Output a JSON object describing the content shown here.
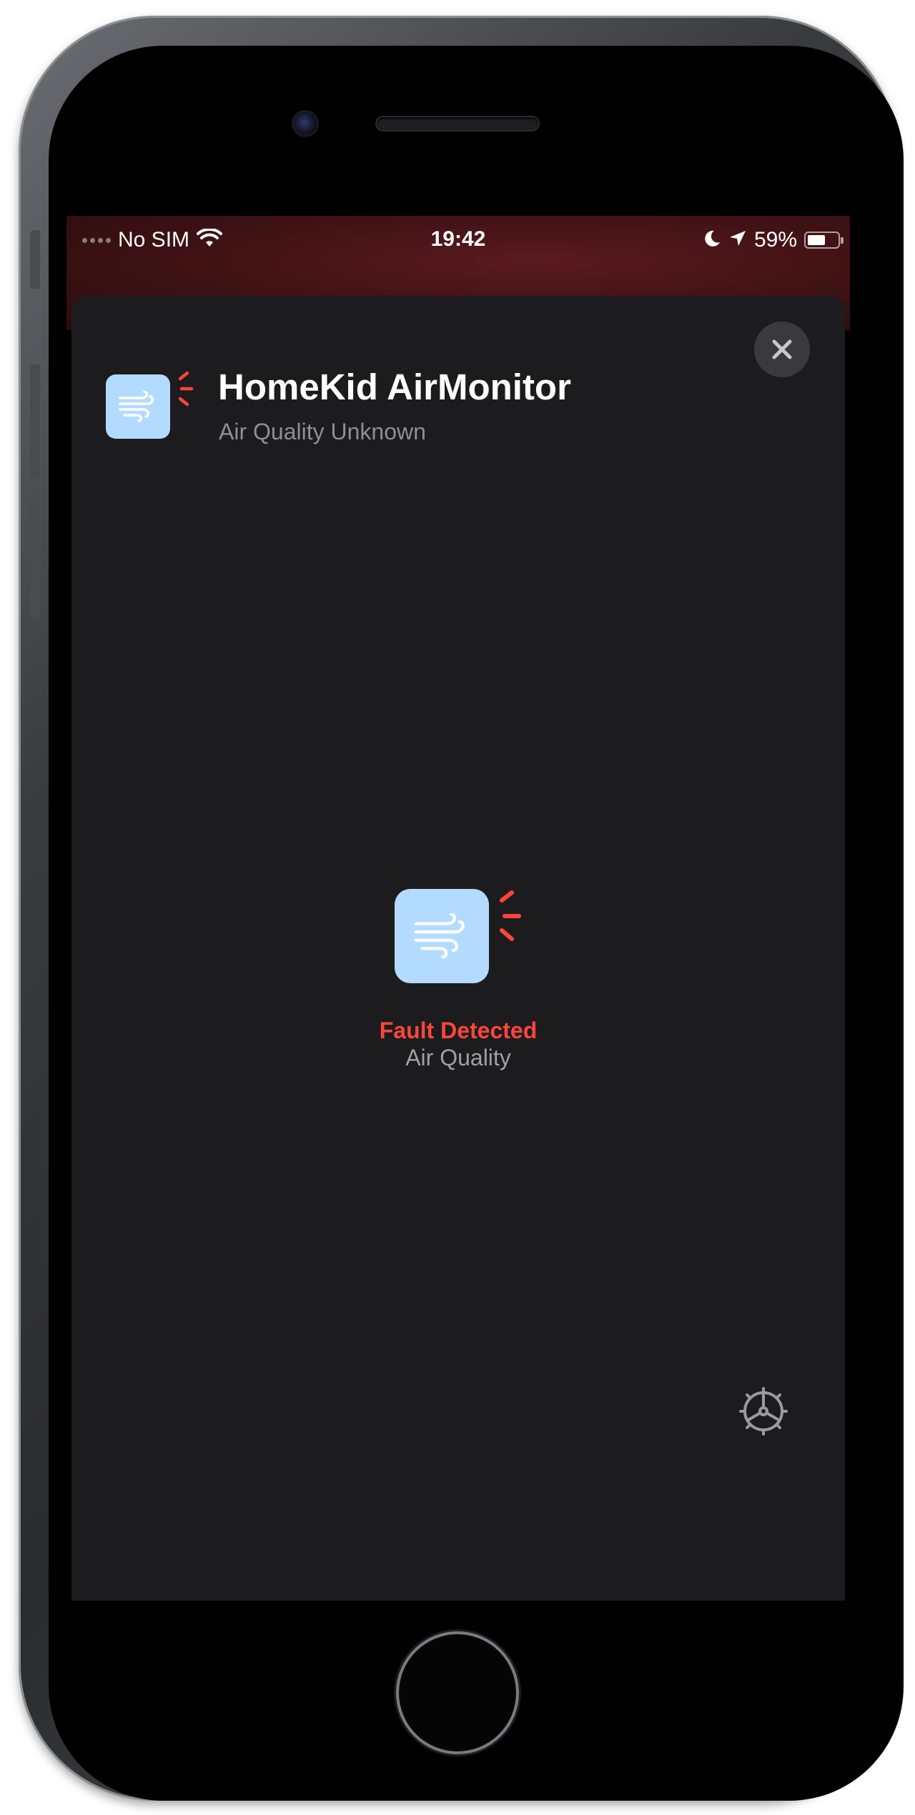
{
  "status_bar": {
    "carrier": "No SIM",
    "time": "19:42",
    "battery_percent": "59%",
    "battery_level": 0.59,
    "icons": [
      "signal-dots-icon",
      "wifi-icon",
      "moon-icon",
      "location-arrow-icon",
      "battery-icon"
    ]
  },
  "accessory": {
    "name": "HomeKid AirMonitor",
    "status": "Air Quality Unknown",
    "icon": "air-quality-wind-icon"
  },
  "tile": {
    "state": "Fault Detected",
    "label": "Air Quality",
    "icon": "air-quality-wind-icon",
    "fault_indicator": "fault-alert-icon"
  },
  "controls": {
    "close_icon": "close-icon",
    "settings_icon": "gear-icon"
  },
  "colors": {
    "sheet_background": "#1c1c1e",
    "tile_background": "#b3dbff",
    "fault_red": "#ff453a",
    "secondary_text": "#8e8e93",
    "wallpaper": "#4a1416"
  }
}
